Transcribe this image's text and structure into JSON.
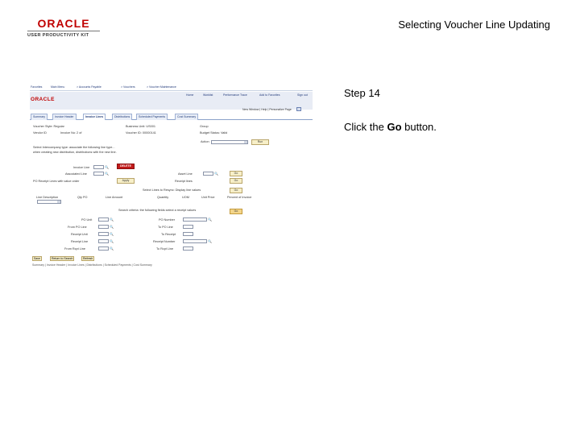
{
  "logo": {
    "oracle": "ORACLE",
    "upk": "USER PRODUCTIVITY KIT"
  },
  "doc_title": "Selecting Voucher Line Updating",
  "step": {
    "title": "Step 14",
    "instruction_pre": "Click the ",
    "instruction_bold": "Go",
    "instruction_post": " button."
  },
  "app": {
    "topnav": [
      "Favorites",
      "Main Menu",
      "> Accounts Payable",
      "> Vouchers",
      "> Voucher Maintenance"
    ],
    "brand": "ORACLE",
    "header_links": [
      "Home",
      "Worklist",
      "Performance Trace",
      "Add to Favorites",
      "Sign out"
    ],
    "new_window": "New Window | Help | Personalize Page",
    "tabs": [
      "Summary",
      "Invoice Header",
      "Invoice Lines",
      "Distributions",
      "Scheduled Payments",
      "Cost Summary"
    ],
    "active_tab": 2,
    "voucher_style": "Voucher Style: Regular",
    "business_unit": "Business Unit: US001",
    "group": "Group",
    "voucher_id_row": "Vendor ID",
    "voucher_id_val": "Voucher ID: 00000141",
    "budget_status": "Budget Status: Valid",
    "invoice_label": "Invoice No: 2 of",
    "action_label": "Action",
    "run_label": "Run",
    "note": "Select Intercompany type: associate the following line type...",
    "note2": "when creating new distribution, distributions with the new line.",
    "invoice_line": "Invoice Line",
    "delete_label": "DELETE",
    "associated_line": "Associated Line",
    "asset_line": "Asset Line",
    "search_line": "PO Receipt Lines with value order",
    "apply_label": "Apply",
    "receipt_lines": "Receipt lines",
    "line_query": "Select Lines to Resync: Display line values",
    "row_header": [
      "Line Description",
      "Qty PO",
      "Line Amount",
      "Quantity",
      "UOM",
      "Unit Price",
      "Percent of Invoice"
    ],
    "search_criteria": "Search criteria: the following fields select a receipt values",
    "go_label": "Go",
    "left_fields": [
      "PO Unit",
      "From PO Line",
      "Receipt Unit",
      "Receipt Line",
      "From Rcpt Line"
    ],
    "right_fields": [
      "PO Number",
      "To PO Line",
      "To Receipt",
      "Receipt Number",
      "To Rcpt Line"
    ],
    "footer_btns": [
      "Save",
      "Return to Search",
      "Refresh"
    ],
    "footer_links": "Summary | Invoice Header | Invoice Lines | Distributions | Scheduled Payments | Cost Summary"
  }
}
